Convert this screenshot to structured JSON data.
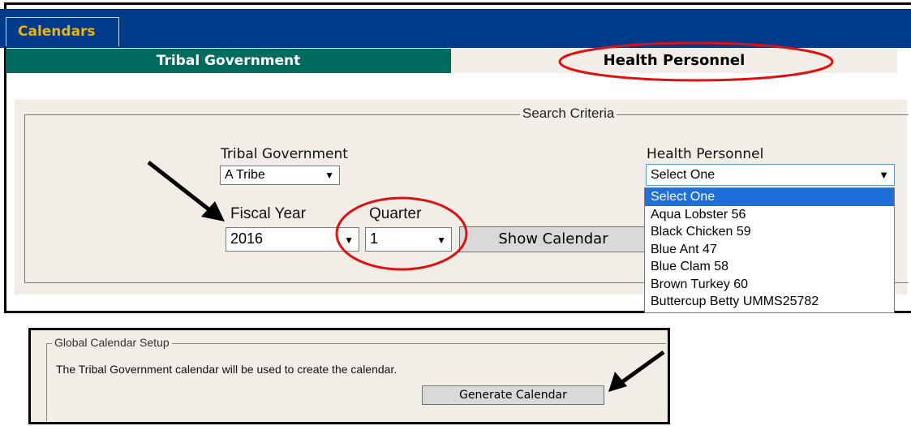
{
  "header": {
    "calendars_tab": "Calendars"
  },
  "tabs": [
    {
      "label": "Tribal Government",
      "active": true
    },
    {
      "label": "Health Personnel",
      "active": false
    }
  ],
  "search": {
    "legend": "Search Criteria",
    "tribal_government": {
      "label": "Tribal Government",
      "value": "A Tribe"
    },
    "fiscal_year": {
      "label": "Fiscal Year",
      "value": "2016"
    },
    "quarter": {
      "label": "Quarter",
      "value": "1"
    },
    "show_calendar_button": "Show Calendar",
    "health_personnel": {
      "label": "Health Personnel",
      "value": "Select One",
      "options": [
        "Select One",
        "Aqua Lobster 56",
        "Black Chicken 59",
        "Blue Ant 47",
        "Blue Clam 58",
        "Brown Turkey 60",
        "Buttercup Betty UMMS25782"
      ],
      "highlighted_index": 0
    }
  },
  "global_setup": {
    "legend": "Global Calendar Setup",
    "message": "The Tribal Government calendar will be used to create the calendar.",
    "generate_button": "Generate Calendar"
  },
  "colors": {
    "header_blue": "#003a8a",
    "tab_green": "#006b5e",
    "calendars_text": "#f0b400",
    "panel_bg": "#f2ede7",
    "annotation_red": "#e01010",
    "selection_blue": "#1e6fd9"
  },
  "icons": {
    "select_arrow": "dropdown-arrow-icon",
    "pointer_arrow": "arrow-annotation-icon"
  }
}
